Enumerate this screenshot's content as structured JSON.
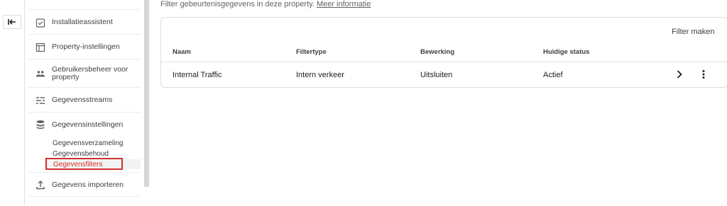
{
  "rail": {
    "back_icon": "collapse-left-arrow-icon"
  },
  "sidebar": {
    "items": [
      {
        "label": "Installatieassistent",
        "icon": "clipboard-check-icon"
      },
      {
        "label": "Property-instellingen",
        "icon": "window-icon"
      },
      {
        "label": "Gebruikersbeheer voor property",
        "icon": "people-icon"
      },
      {
        "label": "Gegevensstreams",
        "icon": "streams-icon"
      },
      {
        "label": "Gegevensinstellingen",
        "icon": "database-icon"
      },
      {
        "label": "Gegevens importeren",
        "icon": "upload-icon"
      }
    ],
    "subitems": [
      "Gegevensverzameling",
      "Gegevensbehoud",
      "Gegevensfilters"
    ],
    "active_subitem": "Gegevensfilters",
    "active_color": "#d93025"
  },
  "main": {
    "intro_text": "Filter gebeurtenisgegevens in deze property.",
    "intro_link": "Meer informatie",
    "create_button": "Filter maken",
    "table": {
      "headers": [
        "Naam",
        "Filtertype",
        "Bewerking",
        "Huidige status"
      ],
      "rows": [
        [
          "Internal Traffic",
          "Intern verkeer",
          "Uitsluiten",
          "Actief"
        ]
      ]
    }
  }
}
